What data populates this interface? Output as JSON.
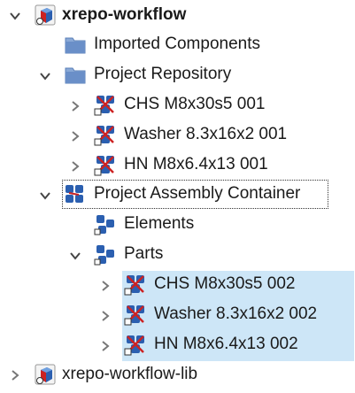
{
  "tree": {
    "root1": {
      "label": "xrepo-workflow",
      "expanded": true
    },
    "imported": {
      "label": "Imported Components"
    },
    "project_repo": {
      "label": "Project Repository",
      "expanded": true
    },
    "repo_items": [
      {
        "label": "CHS M8x30s5 001"
      },
      {
        "label": "Washer 8.3x16x2 001"
      },
      {
        "label": "HN M8x6.4x13 001"
      }
    ],
    "assembly": {
      "label": "Project Assembly Container",
      "expanded": true
    },
    "elements": {
      "label": "Elements"
    },
    "parts": {
      "label": "Parts",
      "expanded": true
    },
    "part_items": [
      {
        "label": "CHS M8x30s5 002",
        "selected": true
      },
      {
        "label": "Washer 8.3x16x2 002",
        "selected": true
      },
      {
        "label": "HN M8x6.4x13 002",
        "selected": true
      }
    ],
    "root2": {
      "label": "xrepo-workflow-lib",
      "expanded": false
    }
  },
  "colors": {
    "selection": "#cde6f7",
    "folder": "#6a8fc8",
    "component_blue": "#2b5fb0",
    "component_red": "#cc2222"
  }
}
